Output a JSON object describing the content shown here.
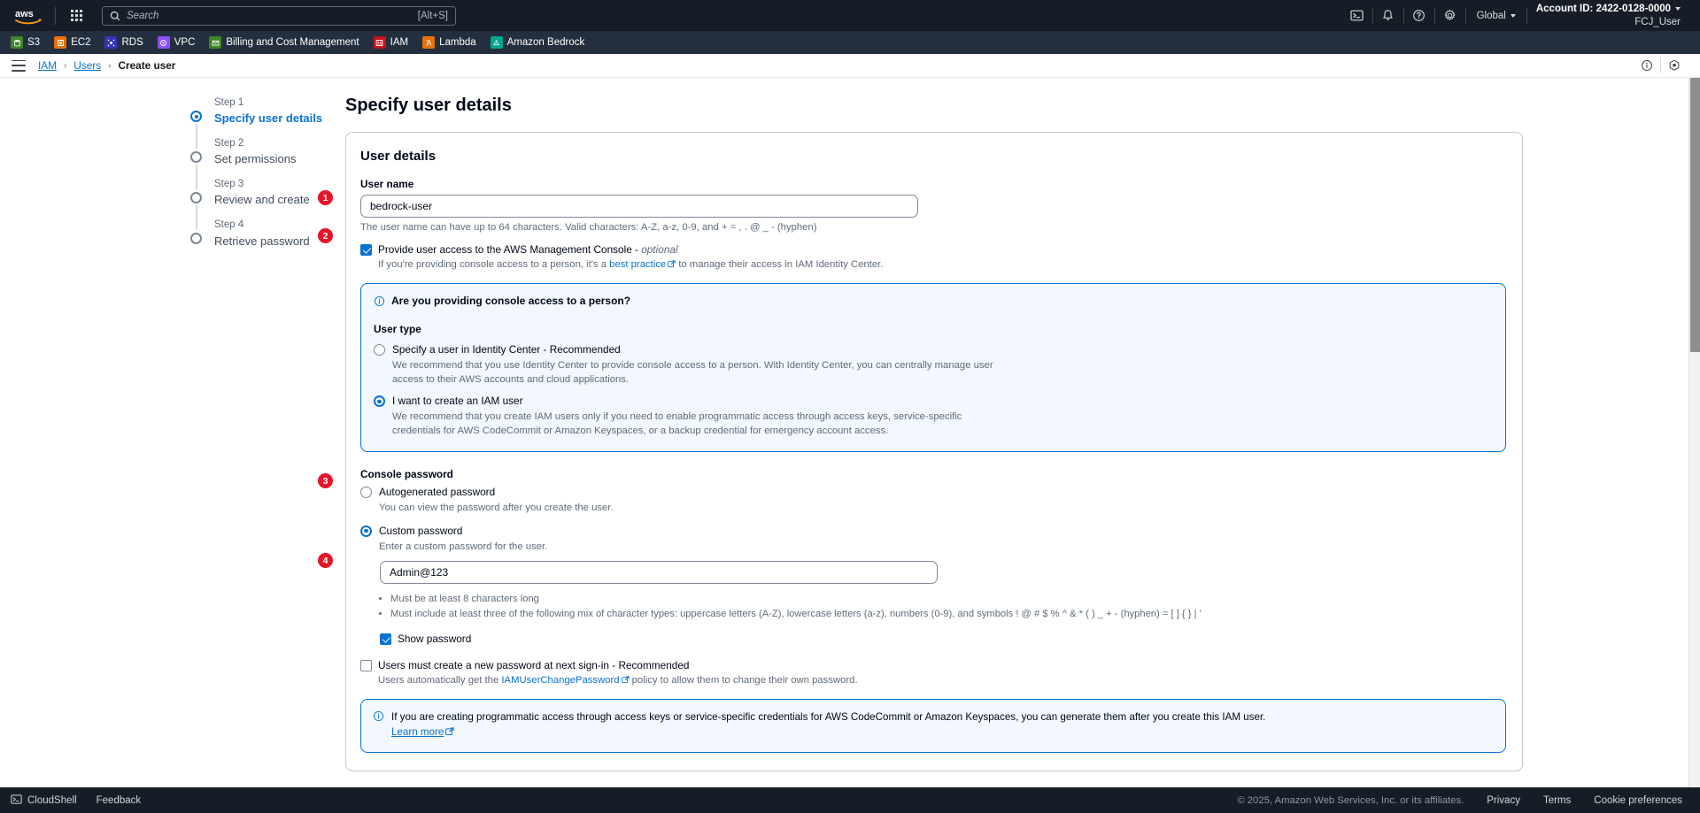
{
  "topnav": {
    "logo_alt": "aws",
    "search_placeholder": "Search",
    "search_value": "",
    "search_shortcut": "[Alt+S]",
    "region": "Global",
    "account_label": "Account ID: 2422-0128-0000",
    "user_label": "FCJ_User",
    "icons": [
      "cloudshell-icon",
      "notifications-icon",
      "help-icon",
      "settings-icon"
    ]
  },
  "servicebar": {
    "items": [
      {
        "label": "S3",
        "color": "#3f8624",
        "glyph": "S3"
      },
      {
        "label": "EC2",
        "color": "#e7710a",
        "glyph": "EC2"
      },
      {
        "label": "RDS",
        "color": "#3334b9",
        "glyph": "RDS"
      },
      {
        "label": "VPC",
        "color": "#8c4fff",
        "glyph": "VPC"
      },
      {
        "label": "Billing and Cost Management",
        "color": "#3f8624",
        "glyph": "B"
      },
      {
        "label": "IAM",
        "color": "#c7131f",
        "glyph": "IAM"
      },
      {
        "label": "Lambda",
        "color": "#e7710a",
        "glyph": "L"
      },
      {
        "label": "Amazon Bedrock",
        "color": "#01a88d",
        "glyph": "AB"
      }
    ]
  },
  "breadcrumb": {
    "items": [
      {
        "label": "IAM",
        "link": true
      },
      {
        "label": "Users",
        "link": true
      },
      {
        "label": "Create user",
        "link": false
      }
    ],
    "separator": "›"
  },
  "steps": [
    {
      "num": "Step 1",
      "name": "Specify user details",
      "active": true
    },
    {
      "num": "Step 2",
      "name": "Set permissions",
      "active": false
    },
    {
      "num": "Step 3",
      "name": "Review and create",
      "active": false
    },
    {
      "num": "Step 4",
      "name": "Retrieve password",
      "active": false
    }
  ],
  "page": {
    "title": "Specify user details",
    "card_title": "User details",
    "username_label": "User name",
    "username_value": "bedrock-user",
    "username_placeholder": "",
    "username_hint": "The user name can have up to 64 characters. Valid characters: A-Z, a-z, 0-9, and + = , . @ _ - (hyphen)",
    "console_access": {
      "label": "Provide user access to the AWS Management Console - ",
      "label_em": "optional",
      "checked": true,
      "hint_pre": "If you're providing console access to a person, it's a ",
      "hint_link": "best practice",
      "hint_post": " to manage their access in IAM Identity Center."
    },
    "infobox": {
      "title": "Are you providing console access to a person?",
      "user_type_label": "User type",
      "options": [
        {
          "label": "Specify a user in Identity Center - Recommended",
          "desc": "We recommend that you use Identity Center to provide console access to a person. With Identity Center, you can centrally manage user access to their AWS accounts and cloud applications.",
          "selected": false
        },
        {
          "label": "I want to create an IAM user",
          "desc": "We recommend that you create IAM users only if you need to enable programmatic access through access keys, service-specific credentials for AWS CodeCommit or Amazon Keyspaces, or a backup credential for emergency account access.",
          "selected": true
        }
      ]
    },
    "console_password": {
      "label": "Console password",
      "options": [
        {
          "label": "Autogenerated password",
          "desc": "You can view the password after you create the user.",
          "selected": false
        },
        {
          "label": "Custom password",
          "desc": "Enter a custom password for the user.",
          "selected": true
        }
      ],
      "password_value": "Admin@123",
      "password_placeholder": "",
      "requirements": [
        "Must be at least 8 characters long",
        "Must include at least three of the following mix of character types: uppercase letters (A-Z), lowercase letters (a-z), numbers (0-9), and symbols ! @ # $ % ^ & * ( ) _ + - (hyphen) = [ ] { } | '"
      ],
      "show_password_label": "Show password",
      "show_password_checked": true
    },
    "next_signin": {
      "label": "Users must create a new password at next sign-in - Recommended",
      "checked": false,
      "hint_pre": "Users automatically get the ",
      "hint_link": "IAMUserChangePassword",
      "hint_post": " policy to allow them to change their own password."
    },
    "bottom_info": {
      "text": "If you are creating programmatic access through access keys or service-specific credentials for AWS CodeCommit or Amazon Keyspaces, you can generate them after you create this IAM user.",
      "link": "Learn more"
    }
  },
  "annotations": [
    {
      "num": "1"
    },
    {
      "num": "2"
    },
    {
      "num": "3"
    },
    {
      "num": "4"
    }
  ],
  "footer": {
    "cloudshell": "CloudShell",
    "feedback": "Feedback",
    "copyright": "© 2025, Amazon Web Services, Inc. or its affiliates.",
    "links": [
      "Privacy",
      "Terms",
      "Cookie preferences"
    ]
  },
  "colors": {
    "accent": "#0972d3",
    "badge": "#e7142a",
    "nav_bg": "#161d26",
    "svc_bg": "#232f3e"
  }
}
